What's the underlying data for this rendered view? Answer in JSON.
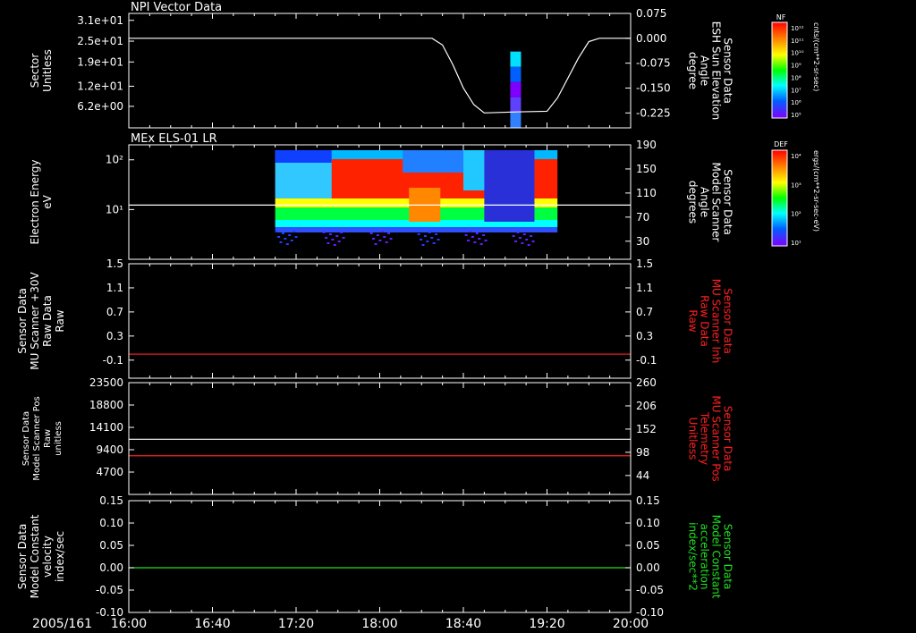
{
  "date_label": "2005/161",
  "time_ticks": [
    "16:00",
    "16:40",
    "17:20",
    "18:00",
    "18:40",
    "19:20",
    "20:00"
  ],
  "time_range": [
    0,
    240
  ],
  "chart_data": [
    {
      "type": "line",
      "title": "NPI Vector Data",
      "left_axis": {
        "label": [
          "Sector",
          "Unitless"
        ],
        "ticks": [
          31,
          25,
          19,
          12,
          6.2
        ],
        "tick_labels": [
          "3.1e+01",
          "2.5e+01",
          "1.9e+01",
          "1.2e+01",
          "6.2e+00"
        ],
        "ylim": [
          0,
          33
        ]
      },
      "right_axis": {
        "label": [
          "Sensor Data",
          "ESH Sun Elevation",
          "Angle",
          "degree"
        ],
        "ticks": [
          0.075,
          0.0,
          -0.075,
          -0.15,
          -0.225
        ],
        "tick_labels": [
          "0.075",
          "0.000",
          "-0.075",
          "-0.150",
          "-0.225"
        ],
        "ylim": [
          -0.27,
          0.075
        ]
      },
      "series": [
        {
          "color": "#ffffff",
          "axis": "right",
          "x": [
            0,
            145,
            150,
            155,
            160,
            165,
            170,
            185,
            200,
            205,
            210,
            215,
            220,
            225,
            240
          ],
          "y": [
            0.0,
            0.0,
            -0.02,
            -0.08,
            -0.15,
            -0.2,
            -0.225,
            -0.222,
            -0.22,
            -0.18,
            -0.12,
            -0.06,
            -0.01,
            0.0,
            0.0
          ]
        }
      ],
      "spectrogram_blocks": [
        {
          "x": 185,
          "y0": 0,
          "y1": 22,
          "note": "NF flux column"
        }
      ],
      "colorbar": {
        "title": "NF",
        "unit": "cnts/(cm**2-sr-sec)",
        "tick_labels": [
          "10¹²",
          "10¹¹",
          "10¹⁰",
          "10⁹",
          "10⁸",
          "10⁷",
          "10⁶",
          "10⁵"
        ]
      }
    },
    {
      "type": "heatmap",
      "title": "MEx ELS-01 LR",
      "left_axis": {
        "label": [
          "Electron Energy",
          "eV"
        ],
        "tick_labels": [
          "10²",
          "10¹"
        ],
        "log": true,
        "ylim": [
          1,
          200
        ]
      },
      "right_axis": {
        "label": [
          "Sensor Data",
          "Model Scanner",
          "Angle",
          "degrees"
        ],
        "ticks": [
          190,
          150,
          110,
          70,
          30
        ],
        "tick_labels": [
          "190",
          "150",
          "110",
          "70",
          "30"
        ],
        "ylim": [
          0,
          190
        ]
      },
      "data_x_range": [
        70,
        205
      ],
      "series": [
        {
          "color": "#ffffff",
          "axis": "right",
          "x": [
            0,
            240
          ],
          "y": [
            90,
            90
          ]
        }
      ],
      "colorbar": {
        "title": "DEF",
        "unit": "ergs/(cm**2-sr-sec-eV)",
        "tick_labels": [
          "10⁴",
          "10³",
          "10²",
          "10¹"
        ]
      }
    },
    {
      "type": "line",
      "left_axis": {
        "label": [
          "Sensor Data",
          "MU Scanner +30V",
          "Raw Data",
          "Raw"
        ],
        "ticks": [
          1.5,
          1.1,
          0.7,
          0.3,
          -0.1
        ],
        "tick_labels": [
          "1.5",
          "1.1",
          "0.7",
          "0.3",
          "-0.1"
        ],
        "ylim": [
          -0.4,
          1.5
        ]
      },
      "right_axis": {
        "label": [
          "Sensor Data",
          "MU Scanner Inh",
          "Raw Data",
          "Raw"
        ],
        "ticks": [
          1.5,
          1.1,
          0.7,
          0.3,
          -0.1
        ],
        "tick_labels": [
          "1.5",
          "1.1",
          "0.7",
          "0.3",
          "-0.1"
        ],
        "ylim": [
          -0.4,
          1.5
        ],
        "color": "#ff2020"
      },
      "series": [
        {
          "color": "#ff2020",
          "axis": "right",
          "x": [
            0,
            240
          ],
          "y": [
            0.0,
            0.0
          ]
        }
      ]
    },
    {
      "type": "line",
      "left_axis": {
        "label": [
          "Sensor Data",
          "Model Scanner Pos",
          "Raw",
          "unitless"
        ],
        "ticks": [
          23500,
          18800,
          14100,
          9400,
          4700
        ],
        "tick_labels": [
          "23500",
          "18800",
          "14100",
          "9400",
          "4700"
        ],
        "ylim": [
          0,
          23500
        ]
      },
      "right_axis": {
        "label": [
          "Sensor Data",
          "MU Scanner Pos",
          "Telemetry",
          "Unitless"
        ],
        "ticks": [
          260,
          206,
          152,
          98,
          44
        ],
        "tick_labels": [
          "260",
          "206",
          "152",
          "98",
          "44"
        ],
        "ylim": [
          0,
          260
        ],
        "color": "#ff2020"
      },
      "series": [
        {
          "color": "#ffffff",
          "axis": "left",
          "x": [
            0,
            240
          ],
          "y": [
            11600,
            11600
          ]
        },
        {
          "color": "#ff2020",
          "axis": "right",
          "x": [
            0,
            240
          ],
          "y": [
            90,
            90
          ]
        }
      ]
    },
    {
      "type": "line",
      "left_axis": {
        "label": [
          "Sensor Data",
          "Model Constant",
          "velocity",
          "index/sec"
        ],
        "ticks": [
          0.15,
          0.1,
          0.05,
          0.0,
          -0.05,
          -0.1
        ],
        "tick_labels": [
          "0.15",
          "0.10",
          "0.05",
          "0.00",
          "-0.05",
          "-0.10"
        ],
        "ylim": [
          -0.1,
          0.15
        ]
      },
      "right_axis": {
        "label": [
          "Sensor Data",
          "Model Constant",
          "acceleration",
          "index/sec**2"
        ],
        "ticks": [
          0.15,
          0.1,
          0.05,
          0.0,
          -0.05,
          -0.1
        ],
        "tick_labels": [
          "0.15",
          "0.10",
          "0.05",
          "0.00",
          "-0.05",
          "-0.10"
        ],
        "ylim": [
          -0.1,
          0.15
        ],
        "color": "#20e020"
      },
      "series": [
        {
          "color": "#20e020",
          "axis": "right",
          "x": [
            0,
            240
          ],
          "y": [
            0.0,
            0.0
          ]
        }
      ]
    }
  ]
}
